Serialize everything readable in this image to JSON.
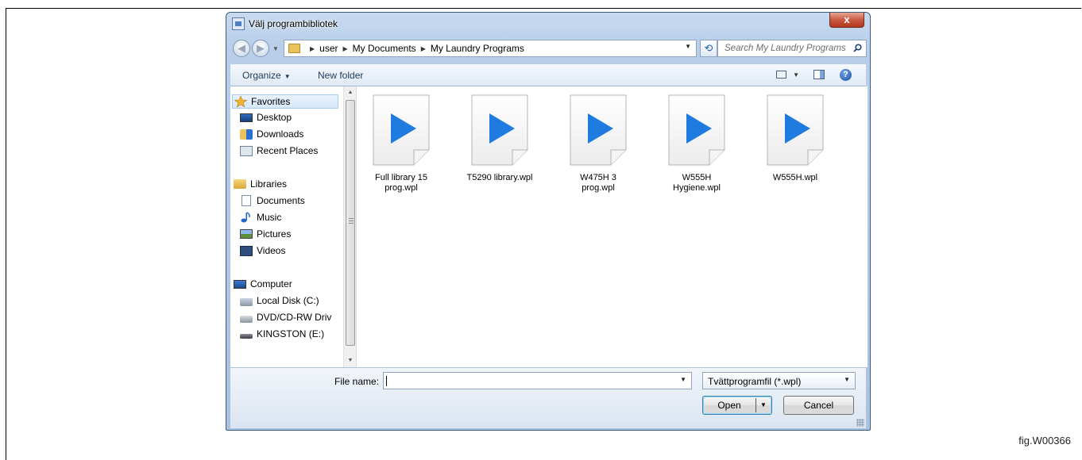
{
  "window": {
    "title": "Välj programbibliotek",
    "close_glyph": "x"
  },
  "address": {
    "breadcrumbs": [
      "user",
      "My Documents",
      "My Laundry Programs"
    ],
    "search_placeholder": "Search My Laundry Programs"
  },
  "toolbar": {
    "organize_label": "Organize",
    "new_folder_label": "New folder",
    "help_glyph": "?"
  },
  "nav": {
    "items": [
      {
        "label": "Favorites",
        "icon": "star-icon",
        "kind": "header"
      },
      {
        "label": "Desktop",
        "icon": "desktop-icon",
        "kind": "item"
      },
      {
        "label": "Downloads",
        "icon": "downloads-icon",
        "kind": "item"
      },
      {
        "label": "Recent Places",
        "icon": "recent-places-icon",
        "kind": "item"
      },
      {
        "label": "Libraries",
        "icon": "libraries-icon",
        "kind": "header"
      },
      {
        "label": "Documents",
        "icon": "documents-icon",
        "kind": "item"
      },
      {
        "label": "Music",
        "icon": "music-icon",
        "kind": "item"
      },
      {
        "label": "Pictures",
        "icon": "pictures-icon",
        "kind": "item"
      },
      {
        "label": "Videos",
        "icon": "videos-icon",
        "kind": "item"
      },
      {
        "label": "Computer",
        "icon": "computer-icon",
        "kind": "header"
      },
      {
        "label": "Local Disk (C:)",
        "icon": "local-disk-icon",
        "kind": "item"
      },
      {
        "label": "DVD/CD-RW Driv",
        "icon": "dvd-drive-icon",
        "kind": "item"
      },
      {
        "label": "KINGSTON (E:)",
        "icon": "usb-drive-icon",
        "kind": "item"
      }
    ]
  },
  "files": [
    {
      "name_line1": "Full library 15",
      "name_line2": "prog.wpl",
      "icon": "playlist-file-icon"
    },
    {
      "name_line1": "T5290 library.wpl",
      "name_line2": "",
      "icon": "playlist-file-icon"
    },
    {
      "name_line1": "W475H 3",
      "name_line2": "prog.wpl",
      "icon": "playlist-file-icon"
    },
    {
      "name_line1": "W555H",
      "name_line2": "Hygiene.wpl",
      "icon": "playlist-file-icon"
    },
    {
      "name_line1": "W555H.wpl",
      "name_line2": "",
      "icon": "playlist-file-icon"
    }
  ],
  "bottom": {
    "file_name_label": "File name:",
    "file_name_value": "",
    "file_type_selected": "Tvättprogramfil (*.wpl)",
    "open_label": "Open",
    "cancel_label": "Cancel"
  },
  "figure_label": "fig.W00366",
  "colors": {
    "play_blue": "#1f7be0",
    "accent": "#3c7fb1"
  }
}
